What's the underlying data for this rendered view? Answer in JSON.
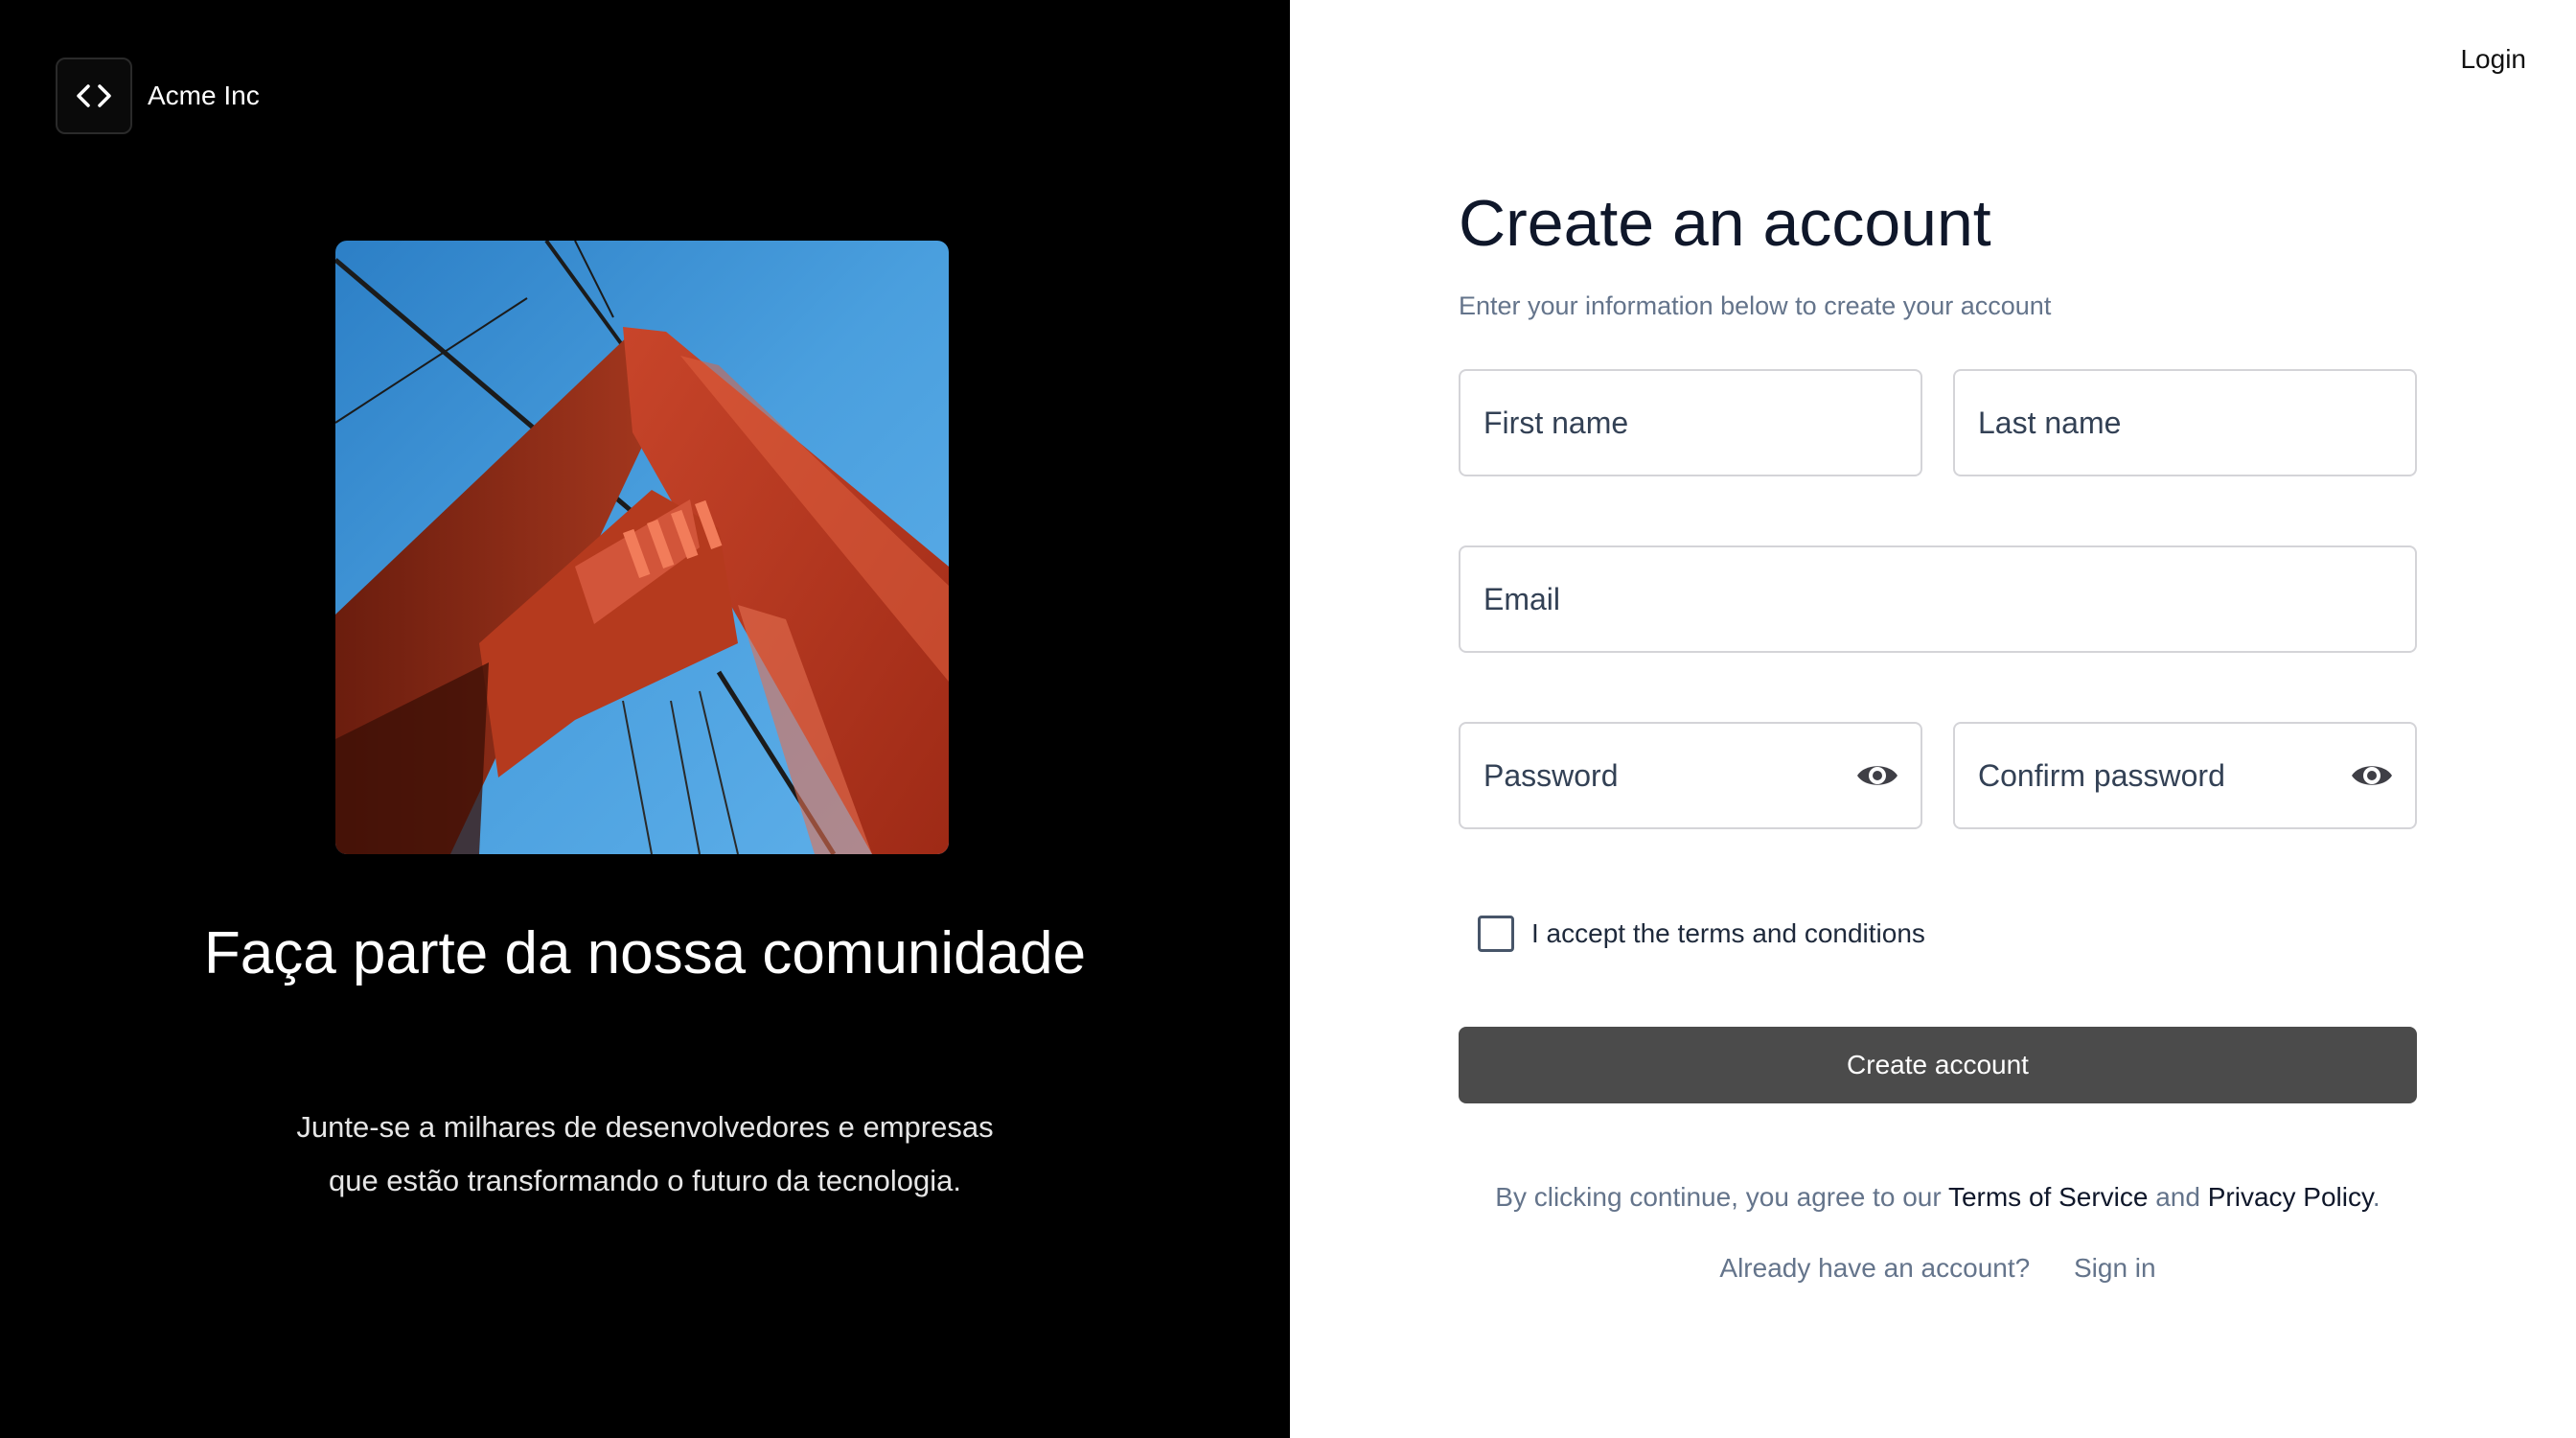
{
  "brand": {
    "name": "Acme Inc",
    "icon": "code-brackets-icon"
  },
  "hero": {
    "image": "golden-gate-bridge-tower-photo",
    "title": "Faça parte da nossa comunidade",
    "subtitle_line1": "Junte-se a milhares de desenvolvedores e empresas",
    "subtitle_line2": "que estão transformando o futuro da tecnologia."
  },
  "header": {
    "login": "Login"
  },
  "form": {
    "title": "Create an account",
    "subtitle": "Enter your information below to create your account",
    "first_name": {
      "placeholder": "First name",
      "value": ""
    },
    "last_name": {
      "placeholder": "Last name",
      "value": ""
    },
    "email": {
      "placeholder": "Email",
      "value": ""
    },
    "password": {
      "placeholder": "Password",
      "value": "",
      "icon": "eye-icon"
    },
    "confirm_password": {
      "placeholder": "Confirm password",
      "value": "",
      "icon": "eye-icon"
    },
    "terms_checkbox": {
      "label": "I accept the terms and conditions",
      "checked": false
    },
    "submit_label": "Create account"
  },
  "legal": {
    "prefix": "By clicking continue, you agree to our",
    "terms": "Terms of Service",
    "and": "and",
    "privacy": "Privacy Policy",
    "suffix": "."
  },
  "signin": {
    "prompt": "Already have an account?",
    "link": "Sign in"
  },
  "colors": {
    "left_bg": "#000000",
    "button_bg": "#4b4b4b",
    "title": "#0f172a",
    "muted": "#64748b"
  }
}
